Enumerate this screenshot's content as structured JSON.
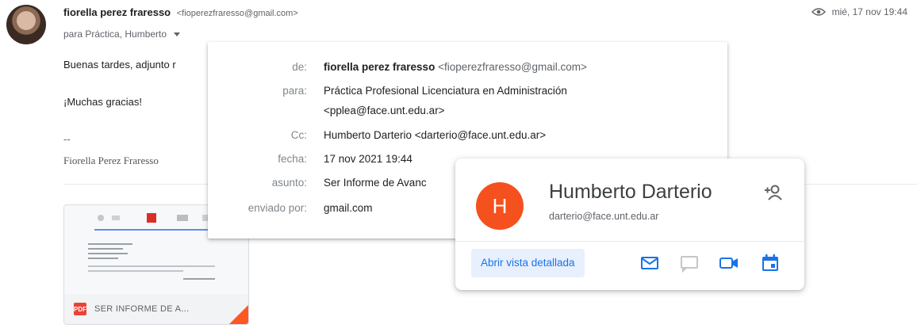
{
  "email": {
    "sender_name": "fiorella perez fraresso",
    "sender_email": "<fioperezfraresso@gmail.com>",
    "recipients": "para Práctica, Humberto",
    "date": "mié, 17 nov 19:44",
    "body_line1": "Buenas tardes, adjunto r",
    "body_line2": "¡Muchas gracias!",
    "sig_dash": "--",
    "signature": "Fiorella Perez Fraresso"
  },
  "attachment": {
    "type_badge": "PDF",
    "name": "SER INFORME DE A..."
  },
  "details": {
    "from_label": "de:",
    "from_name": "fiorella perez fraresso",
    "from_email": "<fioperezfraresso@gmail.com>",
    "to_label": "para:",
    "to_line1": "Práctica Profesional Licenciatura en Administración",
    "to_line2": "<pplea@face.unt.edu.ar>",
    "cc_label": "Cc:",
    "cc_value": "Humberto Darterio <darterio@face.unt.edu.ar>",
    "date_label": "fecha:",
    "date_value": "17 nov 2021 19:44",
    "subject_label": "asunto:",
    "subject_value": "Ser Informe de Avanc",
    "sent_by_label": "enviado por:",
    "sent_by_value": "gmail.com"
  },
  "contact_card": {
    "initial": "H",
    "name": "Humberto Darterio",
    "email": "darterio@face.unt.edu.ar",
    "detail_button": "Abrir vista detallada"
  },
  "colors": {
    "accent_blue": "#1a73e8",
    "avatar_orange": "#f4511e",
    "pdf_red": "#ea4335"
  },
  "icons": [
    "eye-icon",
    "add-contact-icon",
    "mail-icon",
    "chat-icon",
    "video-icon",
    "calendar-icon"
  ]
}
